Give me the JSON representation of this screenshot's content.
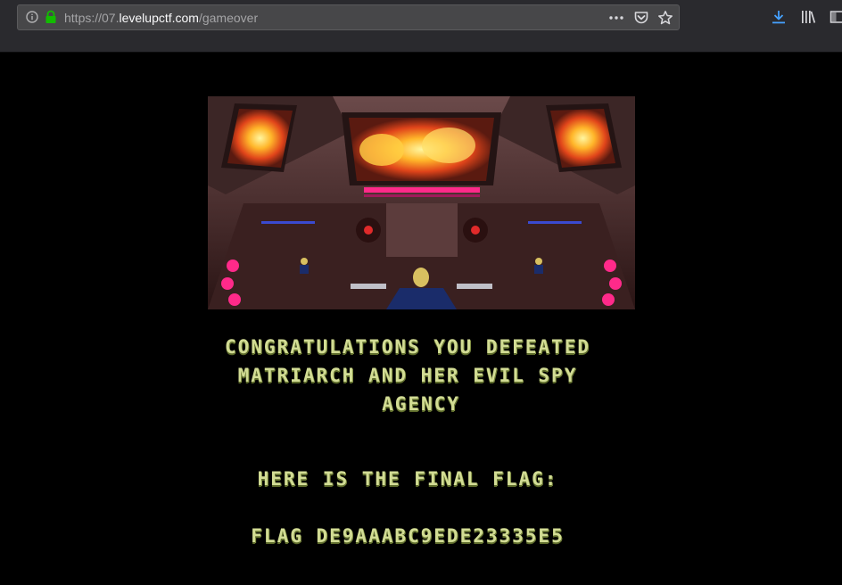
{
  "browser": {
    "url_prefix": "https://07.",
    "url_host": "levelupctf.com",
    "url_path": "/gameover",
    "icons": [
      "info-icon",
      "lock-icon",
      "more-actions-icon",
      "pocket-icon",
      "bookmark-star-icon",
      "download-icon",
      "library-icon",
      "sidebar-icon"
    ],
    "colors": {
      "toolbar": "#2a2a2e",
      "urlbar": "#474749",
      "lock": "#12bc00",
      "download": "#45a1ff"
    }
  },
  "game": {
    "message_line1": "CONGRATULATIONS YOU DEFEATED",
    "message_line2": "MATRIARCH AND HER EVIL SPY",
    "message_line3": "AGENCY",
    "flag_intro": "HERE IS THE FINAL FLAG:",
    "flag_value": "FLAG DE9AAABC9EDE23335E5",
    "text_color": "#d2dc94"
  }
}
